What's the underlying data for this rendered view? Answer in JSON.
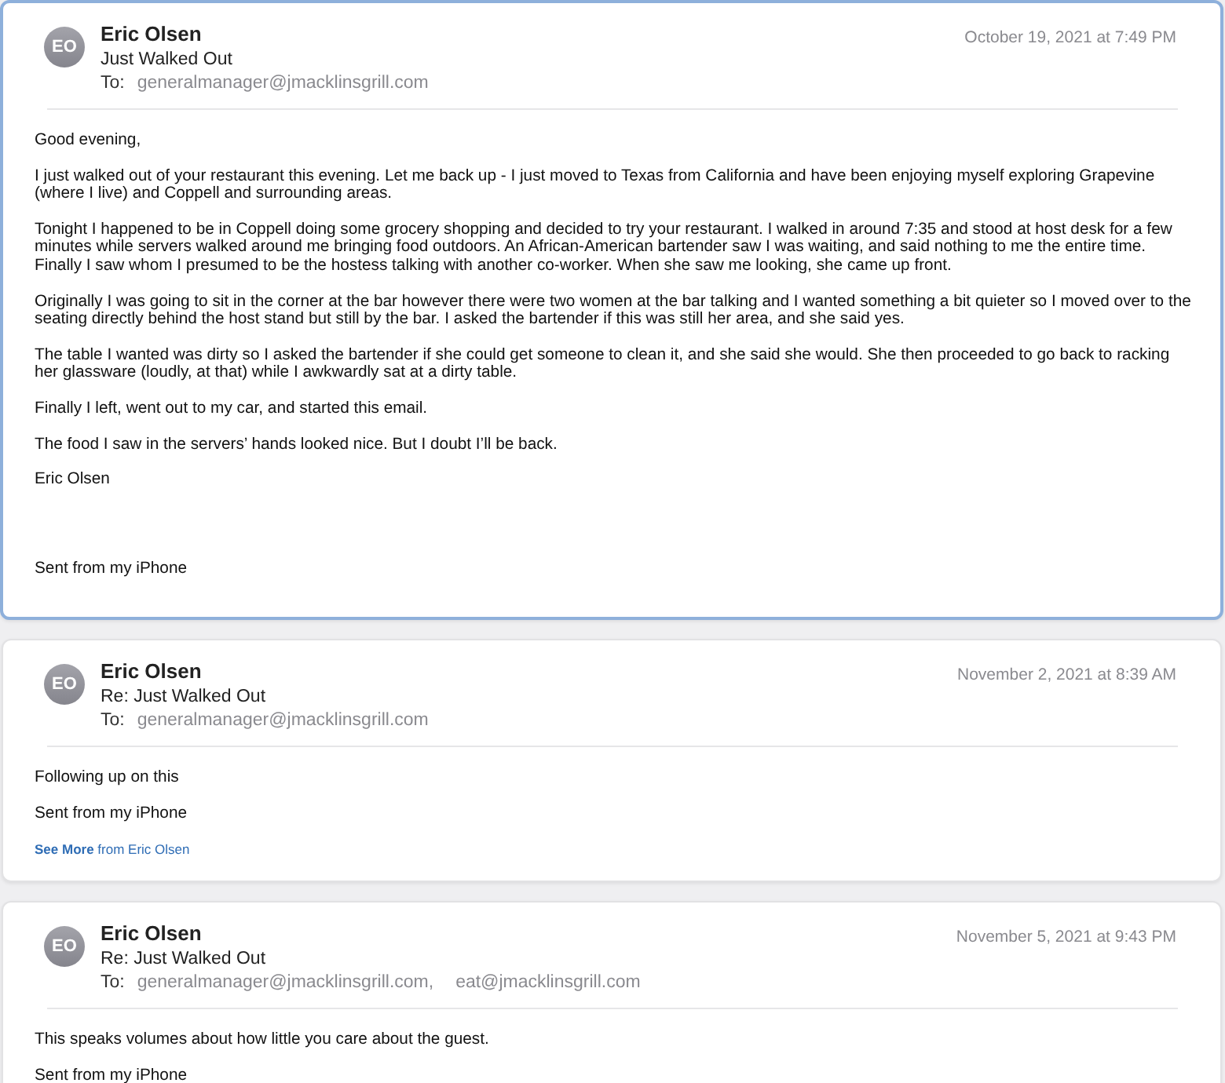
{
  "messages": [
    {
      "initials": "EO",
      "sender": "Eric Olsen",
      "subject": "Just Walked Out",
      "to_label": "To:",
      "recipients": [
        "generalmanager@jmacklinsgrill.com"
      ],
      "date": "October 19, 2021 at 7:49 PM",
      "selected": true,
      "paragraphs": [
        {
          "text": "Good evening,",
          "gap_before": false
        },
        {
          "text": "I just walked out of your restaurant this evening. Let me back up - I just moved to Texas from California and have been enjoying myself exploring Grapevine (where I live) and Coppell and surrounding areas.",
          "gap_before": false
        },
        {
          "text": "Tonight I happened to be in Coppell doing some grocery shopping and decided to try your restaurant. I walked in around 7:35 and stood at host desk for a few minutes while servers walked around me bringing food outdoors. An African-American bartender saw I was waiting, and said nothing to me the entire time. Finally I saw whom I presumed to be the hostess talking with another co-worker. When she saw me looking, she came up front.",
          "gap_before": false
        },
        {
          "text": "Originally I was going to sit in the corner at the bar however there were two women at the bar talking and I wanted something a bit quieter so I moved over to the seating directly behind the host stand but still by the bar. I asked the bartender if this was still her area, and she said yes.",
          "gap_before": false
        },
        {
          "text": "The table I wanted was dirty so I asked the bartender if she could get someone to clean it, and she said she would. She then proceeded to go back to racking her glassware (loudly, at that) while I awkwardly sat at a dirty table.",
          "gap_before": false
        },
        {
          "text": "Finally I left, went out to my car, and started this email.",
          "gap_before": false
        },
        {
          "text": "The food I saw in the servers’ hands looked nice. But I doubt I’ll be back.",
          "gap_before": false
        },
        {
          "text": "Eric Olsen",
          "gap_before": false
        },
        {
          "text": "Sent from my iPhone",
          "gap_before": true
        }
      ]
    },
    {
      "initials": "EO",
      "sender": "Eric Olsen",
      "subject": "Re: Just Walked Out",
      "to_label": "To:",
      "recipients": [
        "generalmanager@jmacklinsgrill.com"
      ],
      "date": "November 2, 2021 at 8:39 AM",
      "selected": false,
      "paragraphs": [
        {
          "text": "Following up on this",
          "gap_before": false
        },
        {
          "text": "Sent from my iPhone",
          "gap_before": false
        }
      ],
      "see_more": {
        "link": "See More",
        "rest": "from Eric Olsen"
      }
    },
    {
      "initials": "EO",
      "sender": "Eric Olsen",
      "subject": "Re: Just Walked Out",
      "to_label": "To:",
      "recipients": [
        "generalmanager@jmacklinsgrill.com,",
        "eat@jmacklinsgrill.com"
      ],
      "date": "November 5, 2021 at 9:43 PM",
      "selected": false,
      "paragraphs": [
        {
          "text": "This speaks volumes about how little you care about the guest.",
          "gap_before": false
        },
        {
          "text": "Sent from my iPhone",
          "gap_before": false
        }
      ]
    }
  ]
}
